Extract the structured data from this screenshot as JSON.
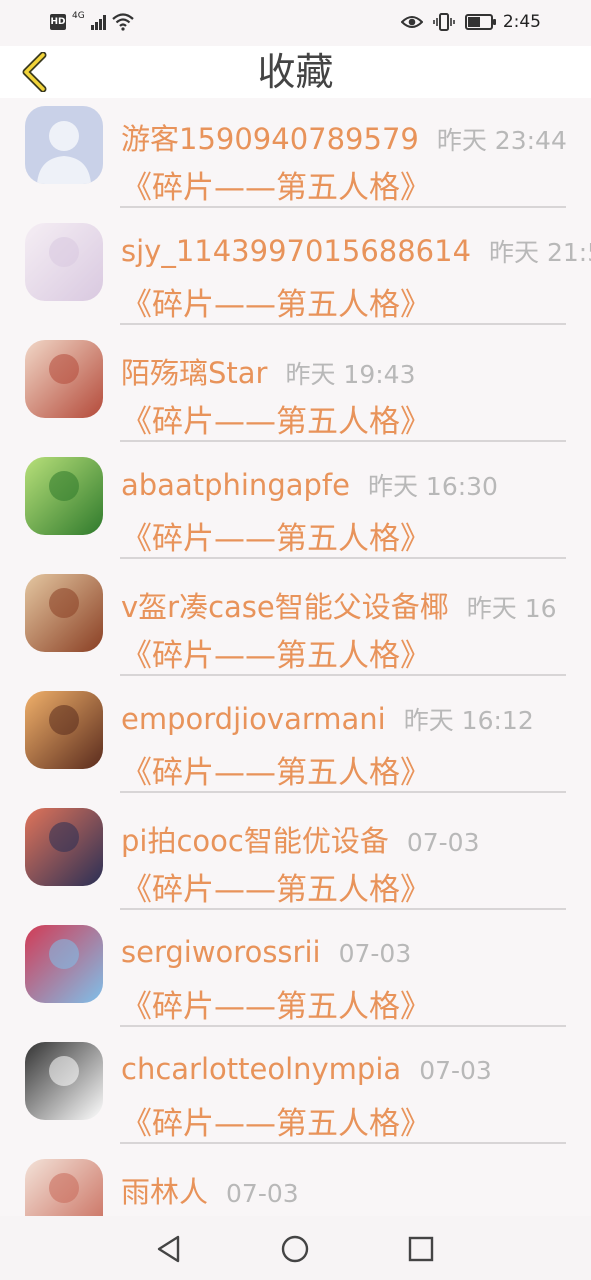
{
  "status_bar": {
    "hd": "HD",
    "network": "4G",
    "time": "2:45",
    "battery_level": 0.6
  },
  "header": {
    "title": "收藏"
  },
  "items": [
    {
      "name": "游客1590940789579",
      "time": "昨天 23:44",
      "book": "《碎片——第五人格》",
      "avatar": "default-avatar",
      "avatar_colors": [
        "#c9d1e8",
        "#eef1f8"
      ]
    },
    {
      "name": "sjy_1143997015688614",
      "time": "昨天 21:5",
      "book": "《碎片——第五人格》",
      "avatar": "anime-lavender-avatar",
      "avatar_colors": [
        "#d9c9e0",
        "#f5eef4"
      ]
    },
    {
      "name": "陌殇璃Star",
      "time": "昨天 19:43",
      "book": "《碎片——第五人格》",
      "avatar": "anime-girl-avatar",
      "avatar_colors": [
        "#b44a3a",
        "#f1d7c7"
      ]
    },
    {
      "name": "abaatphingapfe",
      "time": "昨天 16:30",
      "book": "《碎片——第五人格》",
      "avatar": "green-bottle-avatar",
      "avatar_colors": [
        "#2f7a2c",
        "#b8e07a"
      ]
    },
    {
      "name": "v盔r凑case智能父设备椰",
      "time": "昨天 16",
      "book": "《碎片——第五人格》",
      "avatar": "girl-hair-avatar",
      "avatar_colors": [
        "#8a3f24",
        "#e4c7a1"
      ]
    },
    {
      "name": "empordjiovarmani",
      "time": "昨天 16:12",
      "book": "《碎片——第五人格》",
      "avatar": "warrior-avatar",
      "avatar_colors": [
        "#5a2b1d",
        "#f0b06a"
      ]
    },
    {
      "name": "pi拍cooc智能优设备",
      "time": "07-03",
      "book": "《碎片——第五人格》",
      "avatar": "sunset-tree-avatar",
      "avatar_colors": [
        "#2a2f55",
        "#e0745a"
      ]
    },
    {
      "name": "sergiworossrii",
      "time": "07-03",
      "book": "《碎片——第五人格》",
      "avatar": "cartoon-woman-avatar",
      "avatar_colors": [
        "#7fc0ea",
        "#d23b55"
      ]
    },
    {
      "name": "chcarlotteolnympia",
      "time": "07-03",
      "book": "《碎片——第五人格》",
      "avatar": "sketch-cat-avatar",
      "avatar_colors": [
        "#ffffff",
        "#333333"
      ]
    },
    {
      "name": "雨林人",
      "time": "07-03",
      "book": "",
      "avatar": "floral-avatar",
      "avatar_colors": [
        "#c86a5a",
        "#f3e2d8"
      ]
    }
  ],
  "nav": {
    "icons": [
      "back-triangle-icon",
      "home-circle-icon",
      "recents-square-icon"
    ]
  }
}
